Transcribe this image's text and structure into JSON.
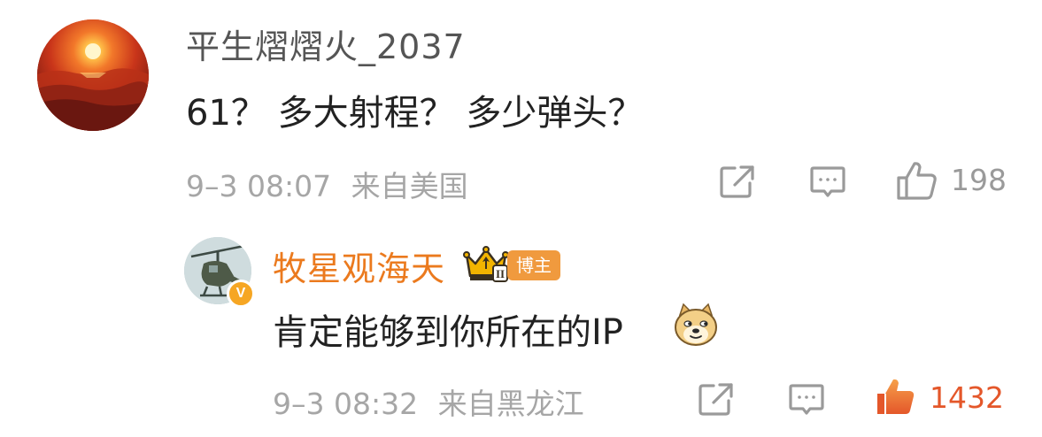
{
  "comments": [
    {
      "username": "平生熠熠火_2037",
      "text": "61？ 多大射程？ 多少弹头？",
      "date": "9–3 08:07",
      "location": "来自美国",
      "likes": "198",
      "liked": false
    },
    {
      "username": "牧星观海天",
      "badge": "博主",
      "crown_level": "II",
      "verified_mark": "V",
      "text": "肯定能够到你所在的IP",
      "emoji": "doge-emoji",
      "date": "9–3 08:32",
      "location": "来自黑龙江",
      "likes": "1432",
      "liked": true
    }
  ],
  "colors": {
    "accent_orange": "#eb7a1e",
    "like_active": "#e4572a",
    "meta_gray": "#a6a6a6",
    "icon_gray": "#9a9a9a",
    "text_dark": "#222222"
  },
  "icons": [
    "share-icon",
    "comment-icon",
    "like-icon",
    "crown-icon",
    "verified-icon",
    "doge-emoji"
  ]
}
